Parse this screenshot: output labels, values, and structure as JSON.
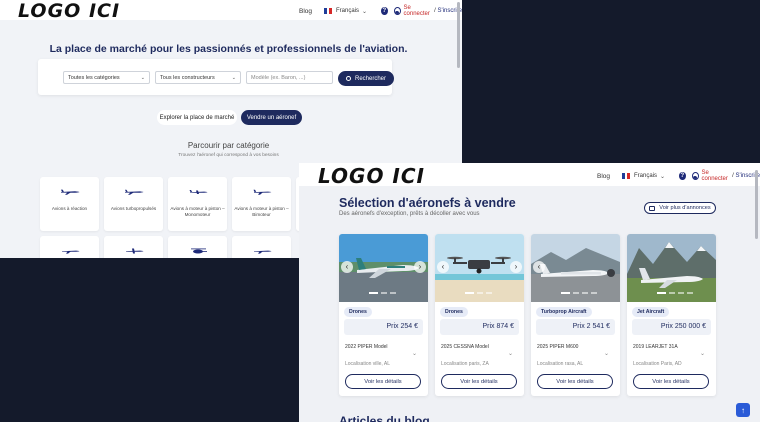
{
  "back_window": {
    "logo": "LOGO ICI",
    "nav": {
      "blog": "Blog",
      "language": "Français",
      "help": "?",
      "login": "Se connecter",
      "separator": " / ",
      "signup": "S'inscrire"
    },
    "hero_title": "La place de marché pour les passionnés et professionnels de l'aviation.",
    "search": {
      "categories": "Toutes les catégories",
      "manufacturers": "Tous les constructeurs",
      "model_placeholder": "Modèle (ex. Baron, ...)",
      "button": "Rechercher"
    },
    "explore_button": "Explorer la place de marché",
    "sell_button": "Vendre un aéronef",
    "browse_title": "Parcourir par catégorie",
    "browse_subtitle": "Trouvez l'aéronef qui correspond à vos besoins",
    "categories": [
      {
        "label": "Avions à réaction"
      },
      {
        "label": "Avions turbopropulsés"
      },
      {
        "label": "Avions à moteur à piston – Monomoteur"
      },
      {
        "label": "Avions à moteur à piston – Bimoteur"
      }
    ],
    "brand_color": "#1e2a5e"
  },
  "front_window": {
    "logo": "LOGO ICI",
    "nav": {
      "blog": "Blog",
      "language": "Français",
      "help": "?",
      "login": "Se connecter",
      "separator": " / ",
      "signup": "S'inscrire"
    },
    "section_title": "Sélection d'aéronefs à vendre",
    "section_subtitle": "Des aéronefs d'exception, prêts à décoller avec vous",
    "see_more": "Voir plus d'annonces",
    "details_label": "Voir les détails",
    "listings": [
      {
        "badge": "Drones",
        "price": "Prix 254 €",
        "model": "2022 PIPER Model",
        "location": "Localisation ville, AL"
      },
      {
        "badge": "Drones",
        "price": "Prix 874 €",
        "model": "2025 CESSNA Model",
        "location": "Localisation paris, ZA"
      },
      {
        "badge": "Turboprop Aircraft",
        "price": "Prix 2 541 €",
        "model": "2025 PIPER M600",
        "location": "Localisation rasa, AL"
      },
      {
        "badge": "Jet Aircraft",
        "price": "Prix 250 000 €",
        "model": "2019 LEARJET 31A",
        "location": "Localisation Paris, AD"
      }
    ],
    "blog_title": "Articles du blog",
    "to_top": "↑"
  }
}
